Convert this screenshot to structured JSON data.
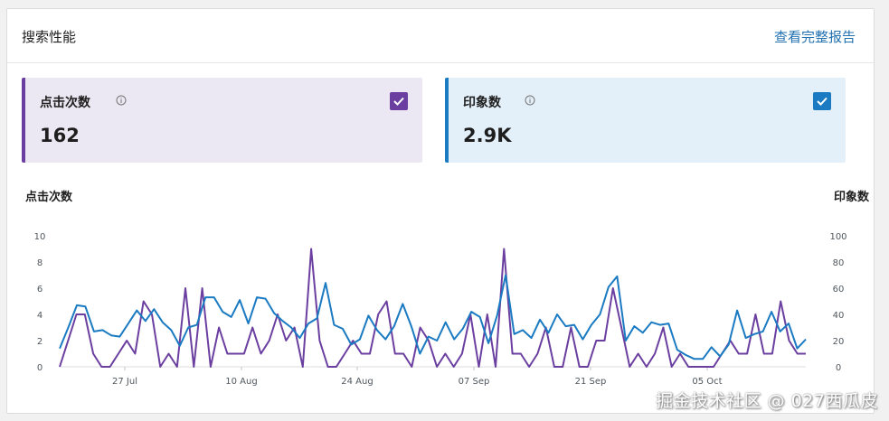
{
  "header": {
    "title": "搜索性能",
    "full_report_link": "查看完整报告"
  },
  "metrics": {
    "clicks": {
      "label": "点击次数",
      "value": "162",
      "color": "#6b3fa0",
      "checked": true
    },
    "impressions": {
      "label": "印象数",
      "value": "2.9K",
      "color": "#1a7ac2",
      "checked": true
    }
  },
  "chart_axes": {
    "left_title": "点击次数",
    "right_title": "印象数"
  },
  "chart_data": {
    "type": "line",
    "x_labels": [
      "27 Jul",
      "10 Aug",
      "24 Aug",
      "07 Sep",
      "21 Sep",
      "05 Oct"
    ],
    "y_left_ticks": [
      "0",
      "2",
      "4",
      "6",
      "8",
      "10"
    ],
    "y_right_ticks": [
      "0",
      "20",
      "40",
      "60",
      "80",
      "100"
    ],
    "ylim_left": [
      0,
      10
    ],
    "ylim_right": [
      0,
      100
    ],
    "series": [
      {
        "name": "点击次数",
        "axis": "left",
        "color": "#6b3fa0",
        "values": [
          0,
          2,
          4,
          4,
          1,
          0,
          0,
          1,
          2,
          1,
          5,
          4,
          0,
          1,
          0,
          6,
          0,
          6,
          0,
          3,
          1,
          1,
          1,
          3,
          1,
          2,
          4,
          2,
          3,
          0,
          9,
          2,
          0,
          0,
          1,
          2,
          1,
          1,
          4,
          5,
          1,
          1,
          0,
          3,
          2,
          0,
          1,
          0,
          1,
          4,
          0,
          4,
          0,
          9,
          1,
          1,
          0,
          1,
          3,
          0,
          0,
          3,
          0,
          0,
          2,
          2,
          6,
          3,
          0,
          1,
          0,
          1,
          3,
          0,
          1,
          0,
          0,
          0,
          0,
          1,
          2,
          1,
          1,
          4,
          1,
          1,
          5,
          2,
          1,
          1
        ]
      },
      {
        "name": "印象数",
        "axis": "right",
        "color": "#1a7ac2",
        "values": [
          14,
          30,
          47,
          46,
          27,
          28,
          24,
          23,
          33,
          43,
          35,
          44,
          34,
          28,
          16,
          30,
          32,
          53,
          53,
          42,
          38,
          51,
          33,
          53,
          52,
          41,
          35,
          30,
          22,
          33,
          37,
          64,
          32,
          29,
          17,
          21,
          39,
          28,
          21,
          31,
          48,
          31,
          10,
          23,
          20,
          34,
          21,
          29,
          42,
          38,
          18,
          39,
          70,
          25,
          28,
          22,
          36,
          26,
          40,
          31,
          32,
          21,
          32,
          40,
          61,
          69,
          20,
          31,
          26,
          34,
          32,
          33,
          13,
          9,
          6,
          6,
          15,
          8,
          17,
          43,
          22,
          25,
          27,
          42,
          27,
          33,
          14,
          21
        ]
      }
    ]
  },
  "watermark": "掘金技术社区 @ 027西瓜皮"
}
